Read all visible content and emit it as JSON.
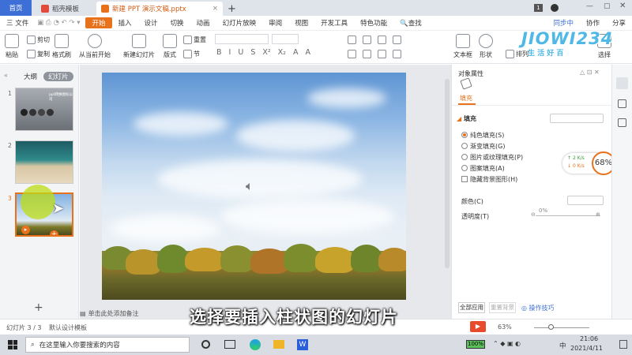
{
  "titlebar": {
    "tabs": [
      {
        "label": "首页"
      },
      {
        "label": "稻壳模板"
      },
      {
        "label": "新建 PPT 演示文稿.pptx"
      }
    ],
    "add_tab": "+",
    "badge": "1"
  },
  "menu": {
    "file_label": "三 文件",
    "items": [
      "开始",
      "插入",
      "设计",
      "切换",
      "动画",
      "幻灯片放映",
      "审阅",
      "视图",
      "开发工具",
      "特色功能"
    ],
    "search_label": "查找",
    "sync_label": "同步中",
    "collab_label": "协作",
    "share_label": "分享"
  },
  "ribbon": {
    "paste": "粘贴",
    "cut": "剪切",
    "copy": "复制",
    "format_painter": "格式刷",
    "play_from_current": "从当前开始",
    "new_slide": "新建幻灯片",
    "layout": "版式",
    "section": "节",
    "reset": "重置",
    "textbox": "文本框",
    "shape": "形状",
    "arrange": "排列",
    "select": "选择",
    "font_buttons": [
      "B",
      "I",
      "U",
      "S",
      "X²",
      "X₂",
      "A",
      "A"
    ]
  },
  "watermark": {
    "brand": "JIOWI234",
    "tagline": "生 活 好 百"
  },
  "left_panel": {
    "tabs": [
      "大纲",
      "幻灯片"
    ],
    "slides": [
      {
        "num": "1",
        "caption": "ppt转换图标公司"
      },
      {
        "num": "2"
      },
      {
        "num": "3"
      }
    ],
    "add_label": "+"
  },
  "notes": {
    "placeholder": "单击此处添加备注"
  },
  "props": {
    "panel_title": "对象属性",
    "fill_tab": "填充",
    "section_fill": "填充",
    "options": [
      "纯色填充(S)",
      "渐变填充(G)",
      "图片或纹理填充(P)",
      "图案填充(A)"
    ],
    "hide_bg": "隐藏背景图形(H)",
    "color_label": "颜色(C)",
    "transparency_label": "透明度(T)",
    "transparency_value": "0%",
    "apply_all": "全部应用",
    "reset_bg": "重置背景",
    "tips": "操作技巧"
  },
  "speed_widget": {
    "up": "2",
    "down": "0",
    "unit": "K/s",
    "percent": "68%"
  },
  "status": {
    "slide_info": "幻灯片 3 / 3",
    "template": "默认设计模板",
    "zoom": "63%"
  },
  "subtitle": "选择要插入柱状图的幻灯片",
  "taskbar": {
    "search_placeholder": "在这里输入你要搜索的内容",
    "battery": "100%",
    "time": "21:06",
    "date": "2021/4/11",
    "lang": "中"
  },
  "colors": {
    "accent": "#e8711c",
    "blue": "#3d6fd6"
  }
}
